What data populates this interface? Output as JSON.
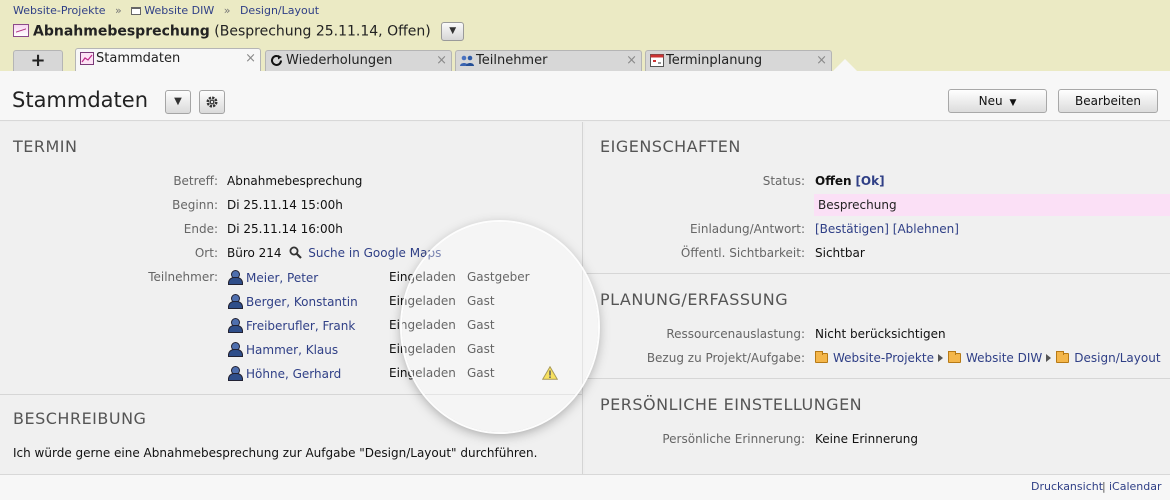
{
  "breadcrumb": [
    "Website-Projekte",
    "Website DIW",
    "Design/Layout"
  ],
  "breadcrumb_sep": "»",
  "title": {
    "name": "Abnahmebesprechung",
    "suffix": "(Besprechung 25.11.14, Offen)"
  },
  "tabs": [
    {
      "label": "Stammdaten",
      "icon": "calendar-chart-icon"
    },
    {
      "label": "Wiederholungen",
      "icon": "repeat-icon"
    },
    {
      "label": "Teilnehmer",
      "icon": "people-icon"
    },
    {
      "label": "Terminplanung",
      "icon": "schedule-icon"
    }
  ],
  "plus_tab": "+",
  "close_glyph": "×",
  "page": {
    "heading": "Stammdaten",
    "neu_label": "Neu",
    "bearbeiten_label": "Bearbeiten"
  },
  "termin": {
    "title": "TERMIN",
    "betreff_label": "Betreff:",
    "betreff": "Abnahmebesprechung",
    "beginn_label": "Beginn:",
    "beginn": "Di 25.11.14 15:00h",
    "ende_label": "Ende:",
    "ende": "Di 25.11.14 16:00h",
    "ort_label": "Ort:",
    "ort": "Büro 214",
    "ort_link": "Suche in Google Maps",
    "teilnehmer_label": "Teilnehmer:",
    "teilnehmer": [
      {
        "name": "Meier, Peter",
        "status": "Eingeladen",
        "role": "Gastgeber",
        "warning": false
      },
      {
        "name": "Berger, Konstantin",
        "status": "Eingeladen",
        "role": "Gast",
        "warning": false
      },
      {
        "name": "Freiberufler, Frank",
        "status": "Eingeladen",
        "role": "Gast",
        "warning": false
      },
      {
        "name": "Hammer, Klaus",
        "status": "Eingeladen",
        "role": "Gast",
        "warning": false
      },
      {
        "name": "Höhne, Gerhard",
        "status": "Eingeladen",
        "role": "Gast",
        "warning": true
      }
    ]
  },
  "beschreibung": {
    "title": "BESCHREIBUNG",
    "text": "Ich würde gerne eine Abnahmebesprechung zur Aufgabe \"Design/Layout\" durchführen."
  },
  "eigenschaften": {
    "title": "EIGENSCHAFTEN",
    "status_label": "Status:",
    "status": "Offen",
    "status_action": "[Ok]",
    "type": "Besprechung",
    "type_color": "#fbe0f6",
    "einladung_label": "Einladung/Antwort:",
    "bestaetigen": "[Bestätigen]",
    "ablehnen": "[Ablehnen]",
    "sichtbarkeit_label": "Öffentl. Sichtbarkeit:",
    "sichtbarkeit": "Sichtbar"
  },
  "planung": {
    "title": "PLANUNG/ERFASSUNG",
    "ressourcen_label": "Ressourcenauslastung:",
    "ressourcen": "Nicht berücksichtigen",
    "bezug_label": "Bezug zu Projekt/Aufgabe:",
    "bezug": [
      "Website-Projekte",
      "Website DIW",
      "Design/Layout"
    ]
  },
  "persoenlich": {
    "title": "PERSÖNLICHE EINSTELLUNGEN",
    "erinnerung_label": "Persönliche Erinnerung:",
    "erinnerung": "Keine Erinnerung"
  },
  "footer": {
    "druckansicht": "Druckansicht",
    "separator": "|",
    "icalendar": "iCalendar"
  },
  "colors": {
    "header_band": "#ebeac4",
    "link": "#2f3f86",
    "warning": "#f5d20a"
  }
}
